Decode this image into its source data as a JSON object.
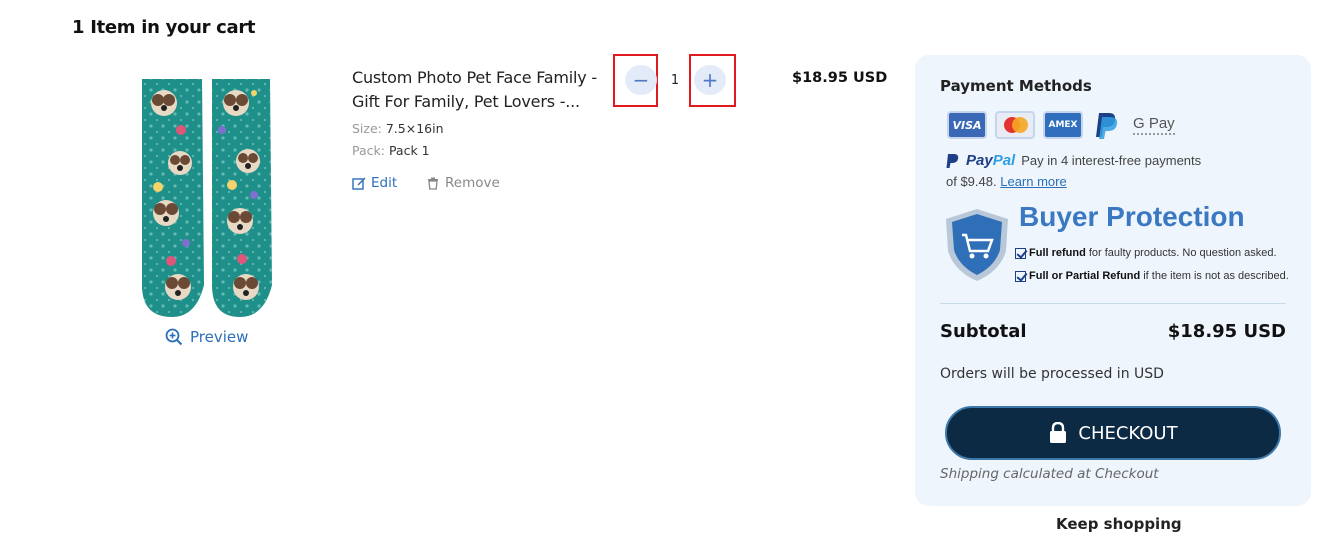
{
  "cart": {
    "heading": "1 Item in your cart"
  },
  "item": {
    "title_line1": "Custom Photo Pet Face Family -",
    "title_line2": "Gift For Family, Pet Lovers -...",
    "size_label": "Size:",
    "size_value": "7.5×16in",
    "pack_label": "Pack:",
    "pack_value": "Pack 1",
    "edit_label": "Edit",
    "remove_label": "Remove",
    "preview_label": "Preview",
    "quantity": "1",
    "quantity_minus_symbol": "−",
    "quantity_plus_symbol": "+",
    "price": "$18.95 USD"
  },
  "summary": {
    "payment_methods_title": "Payment Methods",
    "payment_icons": [
      "visa-icon",
      "mastercard-icon",
      "amex-icon",
      "paypal-icon",
      "google-pay-icon"
    ],
    "visa_text": "VISA",
    "amex_text": "AMEX",
    "gpay_text": "G Pay",
    "paypal_brand_pay": "Pay",
    "paypal_brand_pal": "Pal",
    "paypal_text_line1": "Pay in 4 interest-free payments",
    "paypal_text_line2_prefix": "of $9.48.",
    "paypal_learn_more": "Learn more",
    "buyer_protection_title": "Buyer Protection",
    "bp_line1_bold": "Full refund",
    "bp_line1_rest": "for faulty products. No question asked.",
    "bp_line2_bold": "Full or Partial Refund",
    "bp_line2_rest": "if the item is not as described.",
    "subtotal_label": "Subtotal",
    "subtotal_value": "$18.95 USD",
    "processed_note": "Orders will be processed in USD",
    "checkout_label": "CHECKOUT",
    "shipping_note": "Shipping calculated at Checkout"
  },
  "footer": {
    "keep_shopping": "Keep shopping"
  },
  "colors": {
    "accent": "#2a6fb8",
    "checkout_bg": "#0c2a44",
    "summary_bg": "#eef5fc",
    "highlight_frame": "#e0191e",
    "sock_teal": "#1f8f8a"
  }
}
